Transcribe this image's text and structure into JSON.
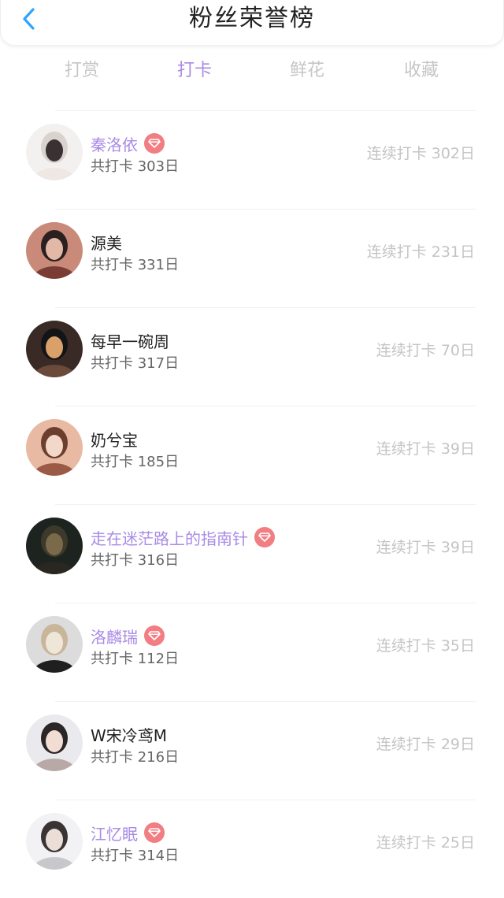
{
  "header": {
    "title": "粉丝荣誉榜",
    "back_icon": "chevron-left-icon"
  },
  "colors": {
    "accent": "#a98be6",
    "badge": "#f27d82",
    "back_icon": "#2fa4ff",
    "muted": "#c4c4c4"
  },
  "tabs": [
    {
      "label": "打赏",
      "active": false
    },
    {
      "label": "打卡",
      "active": true
    },
    {
      "label": "鲜花",
      "active": false
    },
    {
      "label": "收藏",
      "active": false
    }
  ],
  "fans": [
    {
      "name": "秦洛依",
      "vip": true,
      "total": "共打卡 303日",
      "streak": "连续打卡 302日"
    },
    {
      "name": "源美",
      "vip": false,
      "total": "共打卡 331日",
      "streak": "连续打卡 231日"
    },
    {
      "name": "每早一碗周",
      "vip": false,
      "total": "共打卡 317日",
      "streak": "连续打卡 70日"
    },
    {
      "name": "奶兮宝",
      "vip": false,
      "total": "共打卡 185日",
      "streak": "连续打卡 39日"
    },
    {
      "name": "走在迷茫路上的指南针",
      "vip": true,
      "total": "共打卡 316日",
      "streak": "连续打卡 39日"
    },
    {
      "name": "洛麟瑞",
      "vip": true,
      "total": "共打卡 112日",
      "streak": "连续打卡 35日"
    },
    {
      "name": "W宋冷鸢M",
      "vip": false,
      "total": "共打卡 216日",
      "streak": "连续打卡 29日"
    },
    {
      "name": "江忆眠",
      "vip": true,
      "total": "共打卡 314日",
      "streak": "连续打卡 25日"
    }
  ]
}
